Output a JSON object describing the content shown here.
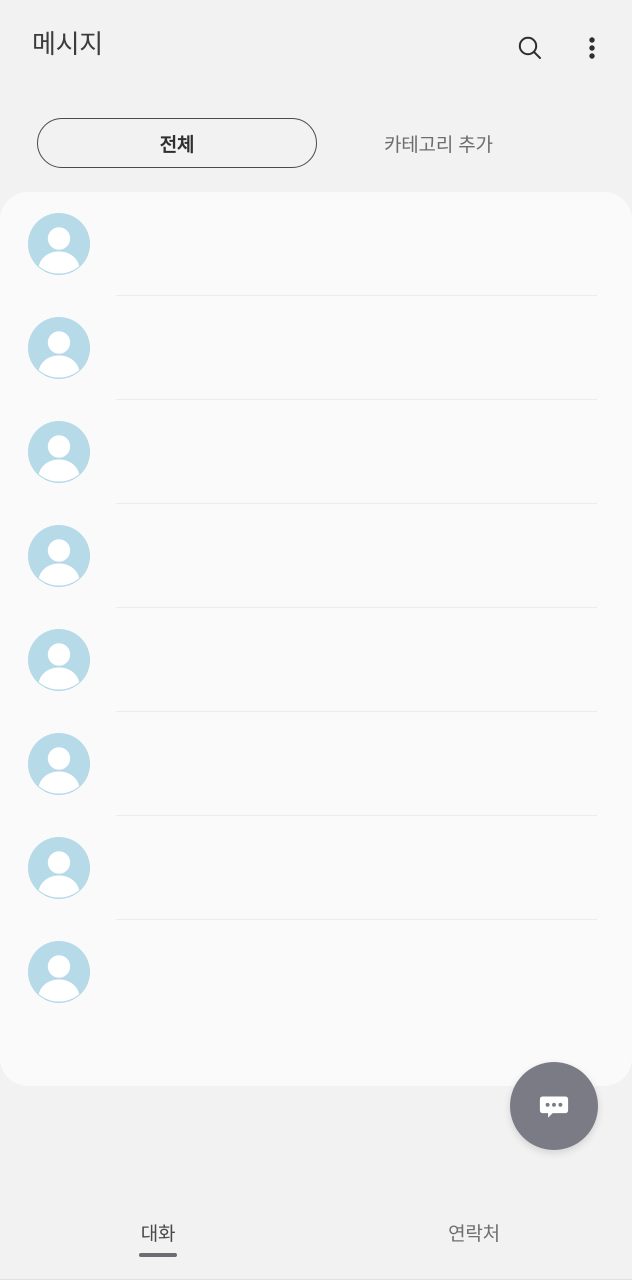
{
  "appbar": {
    "title": "메시지",
    "search_icon": "search-icon",
    "more_icon": "more-vertical-icon"
  },
  "categories": {
    "all_label": "전체",
    "add_label": "카테고리 추가"
  },
  "conversations": {
    "avatar_icon": "default-contact-avatar-icon",
    "avatar_color": "#b6dae7",
    "rows": [
      {
        "name": "",
        "time": "",
        "preview": ""
      },
      {
        "name": "",
        "time": "",
        "preview": ""
      },
      {
        "name": "",
        "time": "",
        "preview": ""
      },
      {
        "name": "",
        "time": "",
        "preview": ""
      },
      {
        "name": "",
        "time": "",
        "preview": ""
      },
      {
        "name": "",
        "time": "",
        "preview": ""
      },
      {
        "name": "",
        "time": "",
        "preview": ""
      },
      {
        "name": "",
        "time": "",
        "preview": ""
      }
    ]
  },
  "fab": {
    "icon": "new-message-bubble-icon",
    "color": "#7b7b86"
  },
  "bottom_nav": {
    "items": [
      {
        "label": "대화",
        "active": true
      },
      {
        "label": "연락처",
        "active": false
      }
    ]
  }
}
